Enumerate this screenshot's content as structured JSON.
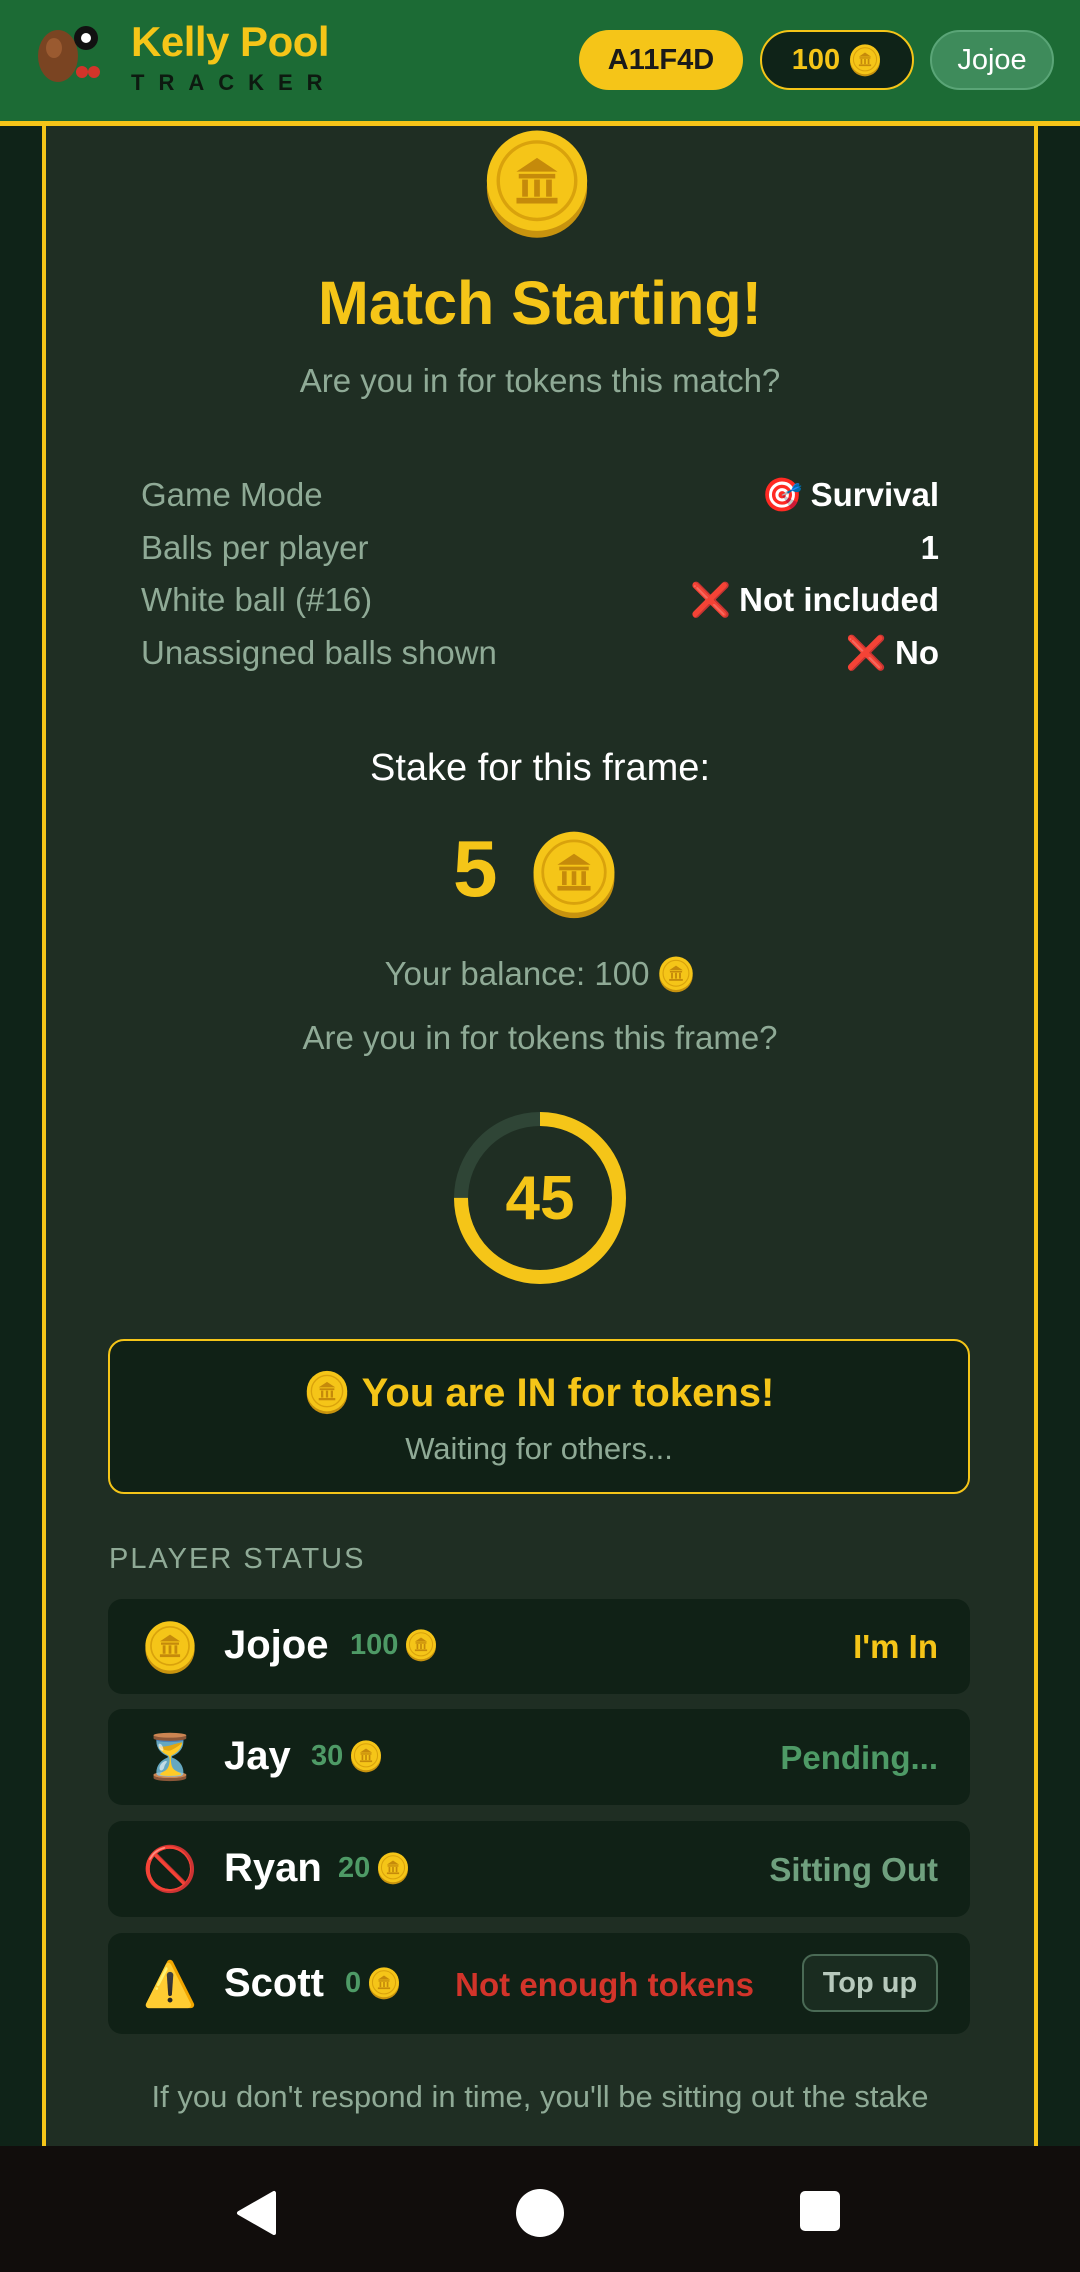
{
  "header": {
    "brand_title": "Kelly Pool",
    "brand_subtitle": "TRACKER",
    "room_code": "A11F4D",
    "balance": "100",
    "user": "Jojoe"
  },
  "match": {
    "title": "Match Starting!",
    "subtitle": "Are you in for tokens this match?",
    "settings": [
      {
        "label": "Game Mode",
        "icon": "🎯",
        "value": "Survival"
      },
      {
        "label": "Balls per player",
        "icon": "",
        "value": "1"
      },
      {
        "label": "White ball (#16)",
        "icon": "❌",
        "value": "Not included"
      },
      {
        "label": "Unassigned balls shown",
        "icon": "❌",
        "value": "No"
      }
    ],
    "stake_label": "Stake for this frame:",
    "stake": "5",
    "balance_text": "Your balance: 100",
    "question": "Are you in for tokens this frame?",
    "timer": "45",
    "timer_progress": 0.75
  },
  "status_box": {
    "title": "You are IN for tokens!",
    "subtitle": "Waiting for others..."
  },
  "players_label": "PLAYER STATUS",
  "players": [
    {
      "icon": "coin-icon",
      "name": "Jojoe",
      "tokens": "100",
      "status": "I'm In"
    },
    {
      "icon": "⏳",
      "name": "Jay",
      "tokens": "30",
      "status": "Pending..."
    },
    {
      "icon": "🚫",
      "name": "Ryan",
      "tokens": "20",
      "status": "Sitting Out"
    },
    {
      "icon": "⚠️",
      "name": "Scott",
      "tokens": "0",
      "status": "Not enough tokens",
      "action": "Top up"
    }
  ],
  "footer_note": "If you don't respond in time, you'll be sitting out the stake",
  "colors": {
    "accent": "#f5c518",
    "header_green": "#1c6b35",
    "panel": "#1f2e23",
    "muted": "#8faa96",
    "error": "#d2342a"
  }
}
